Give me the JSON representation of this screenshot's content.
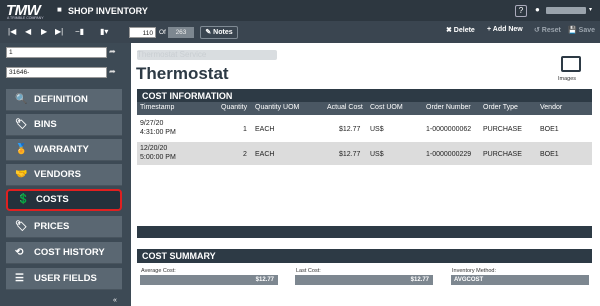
{
  "topbar": {
    "logo": "TMW",
    "logo_sub": "A TRIMBLE COMPANY",
    "title": "SHOP INVENTORY",
    "help": "?",
    "caret": "▾"
  },
  "toolbar": {
    "page": "110",
    "of": "Of",
    "total": "263",
    "notes": "✎ Notes",
    "delete": "✖ Delete",
    "add_new": "+ Add New",
    "reset": "↺ Reset",
    "save": "💾 Save"
  },
  "sidebar": {
    "field1": "1",
    "field2": "31646-",
    "items": [
      {
        "label": "DEFINITION",
        "icon": "🔍"
      },
      {
        "label": "BINS",
        "icon": "🏷"
      },
      {
        "label": "WARRANTY",
        "icon": "🏅"
      },
      {
        "label": "VENDORS",
        "icon": "🤝"
      },
      {
        "label": "COSTS",
        "icon": "💲"
      },
      {
        "label": "PRICES",
        "icon": "🏷"
      },
      {
        "label": "COST HISTORY",
        "icon": "⟲"
      },
      {
        "label": "USER FIELDS",
        "icon": "☰"
      }
    ],
    "collapse": "«"
  },
  "main": {
    "subtitle": "Thermostat Service",
    "title": "Thermostat",
    "images_label": "Images",
    "cost_info_title": "COST INFORMATION",
    "columns": [
      "Timestamp",
      "Quantity",
      "Quantity UOM",
      "Actual Cost",
      "Cost UOM",
      "Order Number",
      "Order Type",
      "Vendor"
    ],
    "rows": [
      {
        "ts1": "9/27/20",
        "ts2": "4:31:00 PM",
        "qty": "1",
        "uom": "EACH",
        "cost": "$12.77",
        "cuom": "US$",
        "order": "1-0000000062",
        "type": "PURCHASE",
        "vendor": "BOE1"
      },
      {
        "ts1": "12/20/20",
        "ts2": "5:00:00 PM",
        "qty": "2",
        "uom": "EACH",
        "cost": "$12.77",
        "cuom": "US$",
        "order": "1-0000000229",
        "type": "PURCHASE",
        "vendor": "BOE1"
      }
    ],
    "summary_title": "COST SUMMARY",
    "avg_label": "Average Cost:",
    "avg_value": "$12.77",
    "last_label": "Last Cost:",
    "last_value": "$12.77",
    "method_label": "Inventory Method:",
    "method_value": "AVGCOST"
  }
}
